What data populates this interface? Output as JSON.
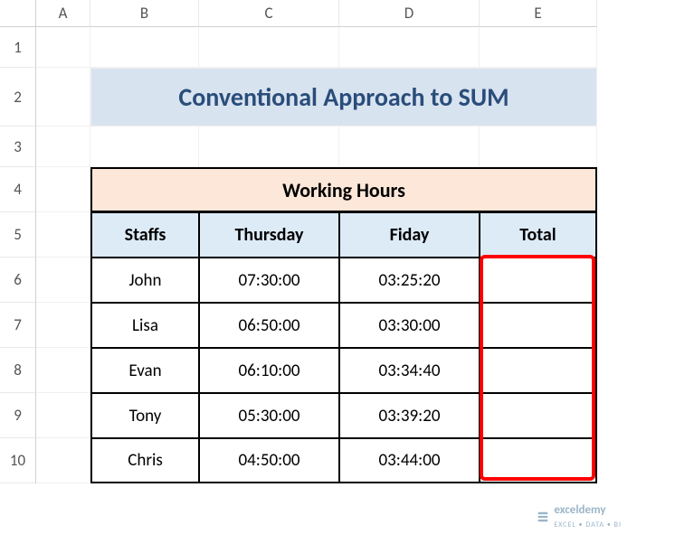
{
  "columns": [
    "A",
    "B",
    "C",
    "D",
    "E"
  ],
  "rows": [
    "1",
    "2",
    "3",
    "4",
    "5",
    "6",
    "7",
    "8",
    "9",
    "10"
  ],
  "title": "Conventional Approach to SUM",
  "table_header": "Working Hours",
  "col_labels": {
    "staffs": "Staffs",
    "thursday": "Thursday",
    "friday": "Fiday",
    "total": "Total"
  },
  "data": [
    {
      "staff": "John",
      "thursday": "07:30:00",
      "friday": "03:25:20",
      "total": ""
    },
    {
      "staff": "Lisa",
      "thursday": "06:50:00",
      "friday": "03:30:00",
      "total": ""
    },
    {
      "staff": "Evan",
      "thursday": "06:10:00",
      "friday": "03:34:40",
      "total": ""
    },
    {
      "staff": "Tony",
      "thursday": "05:30:00",
      "friday": "03:39:20",
      "total": ""
    },
    {
      "staff": "Chris",
      "thursday": "04:50:00",
      "friday": "03:44:00",
      "total": ""
    }
  ],
  "watermark": {
    "brand": "exceldemy",
    "tagline": "EXCEL • DATA • BI"
  },
  "chart_data": {
    "type": "table",
    "title": "Working Hours",
    "columns": [
      "Staffs",
      "Thursday",
      "Fiday",
      "Total"
    ],
    "rows": [
      [
        "John",
        "07:30:00",
        "03:25:20",
        ""
      ],
      [
        "Lisa",
        "06:50:00",
        "03:30:00",
        ""
      ],
      [
        "Evan",
        "06:10:00",
        "03:34:40",
        ""
      ],
      [
        "Tony",
        "05:30:00",
        "03:39:20",
        ""
      ],
      [
        "Chris",
        "04:50:00",
        "03:44:00",
        ""
      ]
    ]
  }
}
